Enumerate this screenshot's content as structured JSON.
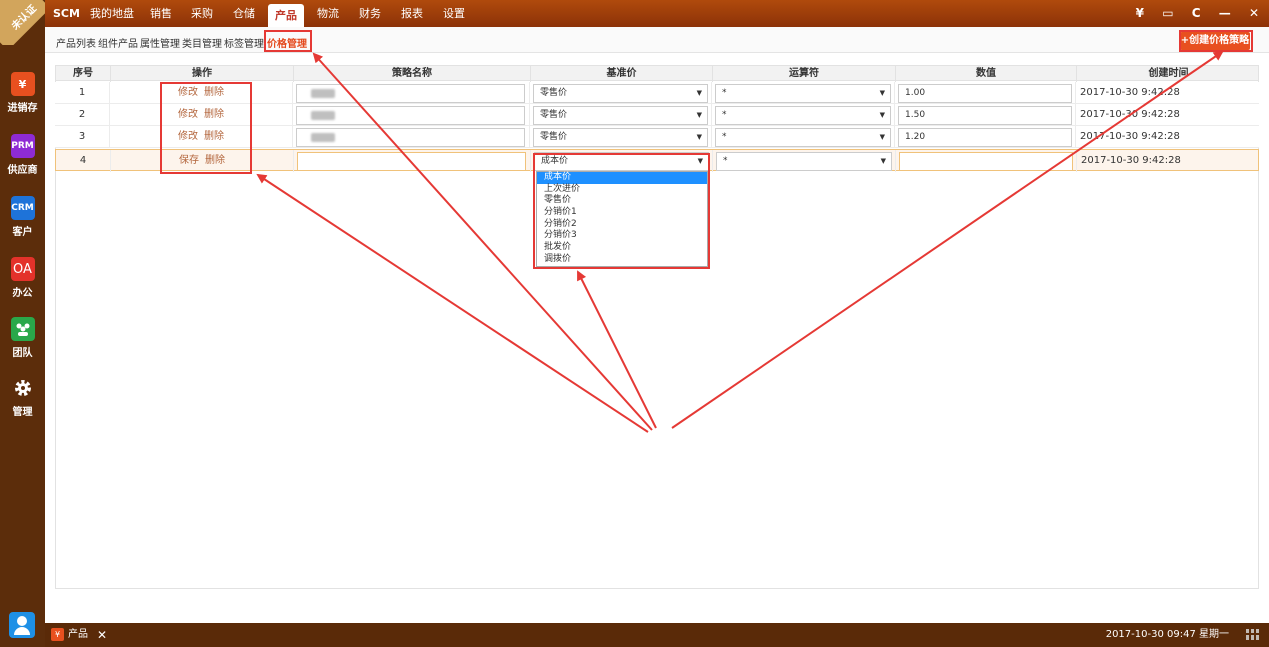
{
  "badge": "未认证",
  "top_tabs": [
    "SCM",
    "我的地盘",
    "销售",
    "采购",
    "仓储",
    "产品",
    "物流",
    "财务",
    "报表",
    "设置"
  ],
  "active_top_tab": "产品",
  "top_icons": {
    "yen": "¥",
    "chat": "▭",
    "refresh": "C",
    "minimize": "—",
    "close": "✕"
  },
  "sidebar": [
    {
      "label": "进销存",
      "icon": "¥",
      "color": "#e8501f"
    },
    {
      "label": "供应商",
      "icon": "PRM",
      "color": "#8e2bd4"
    },
    {
      "label": "客户",
      "icon": "CRM",
      "color": "#1e73d9"
    },
    {
      "label": "办公",
      "icon": "OA",
      "color": "#e3322a"
    },
    {
      "label": "团队",
      "icon": "team-icon",
      "color": "#2aa84a"
    },
    {
      "label": "管理",
      "icon": "gear-icon",
      "color": "transparent"
    }
  ],
  "sub_tabs": [
    "产品列表",
    "组件产品",
    "属性管理",
    "类目管理",
    "标签管理",
    "价格管理"
  ],
  "active_sub_tab": "价格管理",
  "create_button": "+创建价格策略",
  "table": {
    "headers": [
      "序号",
      "操作",
      "策略名称",
      "基准价",
      "运算符",
      "数值",
      "创建时间"
    ],
    "rows": [
      {
        "no": "1",
        "act1": "修改",
        "act2": "删除",
        "base": "零售价",
        "op": "*",
        "value": "1.00",
        "time": "2017-10-30 9:42:28"
      },
      {
        "no": "2",
        "act1": "修改",
        "act2": "删除",
        "base": "零售价",
        "op": "*",
        "value": "1.50",
        "time": "2017-10-30 9:42:28"
      },
      {
        "no": "3",
        "act1": "修改",
        "act2": "删除",
        "base": "零售价",
        "op": "*",
        "value": "1.20",
        "time": "2017-10-30 9:42:28"
      },
      {
        "no": "4",
        "act1": "保存",
        "act2": "删除",
        "base": "成本价",
        "op": "*",
        "value": "",
        "time": "2017-10-30 9:42:28"
      }
    ]
  },
  "dropdown_options": [
    "成本价",
    "上次进价",
    "零售价",
    "分销价1",
    "分销价2",
    "分销价3",
    "批发价",
    "调拨价"
  ],
  "dropdown_selected": "成本价",
  "bottom": {
    "tab_label": "产品",
    "clock": "2017-10-30 09:47 星期一"
  },
  "annotation_color": "#e53935"
}
